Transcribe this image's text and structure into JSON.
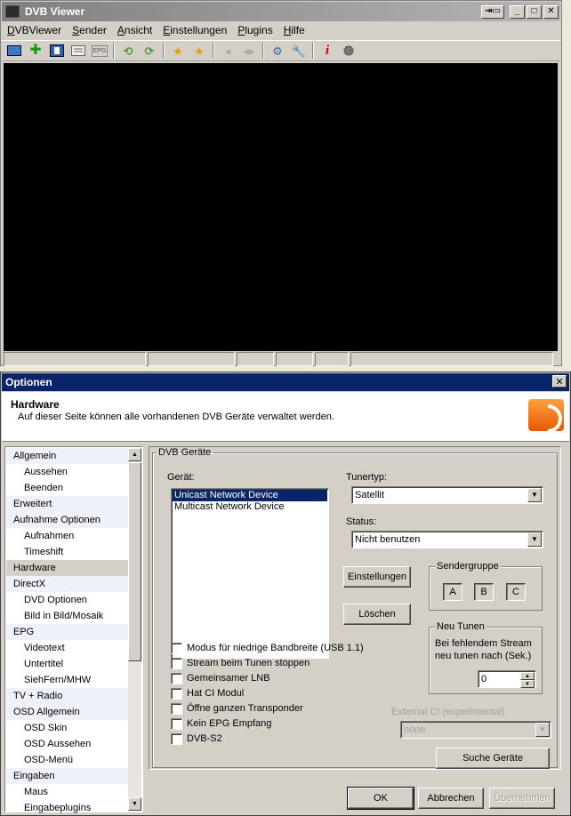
{
  "viewer": {
    "title": "DVB Viewer",
    "window_buttons": [
      "⇥▭",
      "_",
      "□",
      "✕"
    ],
    "menu": [
      "DVBViewer",
      "Sender",
      "Ansicht",
      "Einstellungen",
      "Plugins",
      "Hilfe"
    ],
    "toolbar_glyph_epg": "EPG"
  },
  "options": {
    "title": "Optionen",
    "close": "✕",
    "header": {
      "title": "Hardware",
      "description": "Auf dieser Seite können alle vorhandenen DVB Geräte verwaltet werden."
    },
    "nav": [
      {
        "label": "Allgemein",
        "kind": "cat"
      },
      {
        "label": "Aussehen",
        "kind": "sub"
      },
      {
        "label": "Beenden",
        "kind": "sub"
      },
      {
        "label": "Erweitert",
        "kind": "cat"
      },
      {
        "label": "Aufnahme Optionen",
        "kind": "cat"
      },
      {
        "label": "Aufnahmen",
        "kind": "sub"
      },
      {
        "label": "Timeshift",
        "kind": "sub"
      },
      {
        "label": "Hardware",
        "kind": "sel"
      },
      {
        "label": "DirectX",
        "kind": "cat"
      },
      {
        "label": "DVD Optionen",
        "kind": "sub"
      },
      {
        "label": "Bild in Bild/Mosaik",
        "kind": "sub"
      },
      {
        "label": "EPG",
        "kind": "cat"
      },
      {
        "label": "Videotext",
        "kind": "sub"
      },
      {
        "label": "Untertitel",
        "kind": "sub"
      },
      {
        "label": "SiehFern/MHW",
        "kind": "sub"
      },
      {
        "label": "TV + Radio",
        "kind": "cat"
      },
      {
        "label": "OSD Allgemein",
        "kind": "cat"
      },
      {
        "label": "OSD Skin",
        "kind": "sub"
      },
      {
        "label": "OSD Aussehen",
        "kind": "sub"
      },
      {
        "label": "OSD-Menü",
        "kind": "sub"
      },
      {
        "label": "Eingaben",
        "kind": "cat"
      },
      {
        "label": "Maus",
        "kind": "sub"
      },
      {
        "label": "Eingabeplugins",
        "kind": "sub"
      }
    ],
    "dvb": {
      "group_label": "DVB Geräte",
      "device_label": "Gerät:",
      "devices": [
        "Unicast Network Device",
        "Multicast Network Device"
      ],
      "selected_device": 0,
      "tunertype_label": "Tunertyp:",
      "tunertype_value": "Satellit",
      "status_label": "Status:",
      "status_value": "Nicht benutzen",
      "settings_button": "Einstellungen",
      "delete_button": "Löschen",
      "sendergruppe_label": "Sendergruppe",
      "groups": [
        "A",
        "B",
        "C"
      ],
      "neu_tunen_label": "Neu Tunen",
      "neu_tunen_text1": "Bei fehlendem Stream",
      "neu_tunen_text2": "neu tunen nach (Sek.)",
      "neu_tunen_value": "0",
      "checkboxes": [
        "Modus für niedrige Bandbreite (USB 1.1)",
        "Stream beim Tunen stoppen",
        "Gemeinsamer LNB",
        "Hat CI Modul",
        "Öffne ganzen Transponder",
        "Kein EPG Empfang",
        "DVB-S2"
      ],
      "external_ci_label": "External CI (experimental)",
      "external_ci_value": "none",
      "search_button": "Suche Geräte"
    },
    "ok_button": "OK",
    "cancel_button": "Abbrechen",
    "apply_button": "Übernehmen"
  }
}
